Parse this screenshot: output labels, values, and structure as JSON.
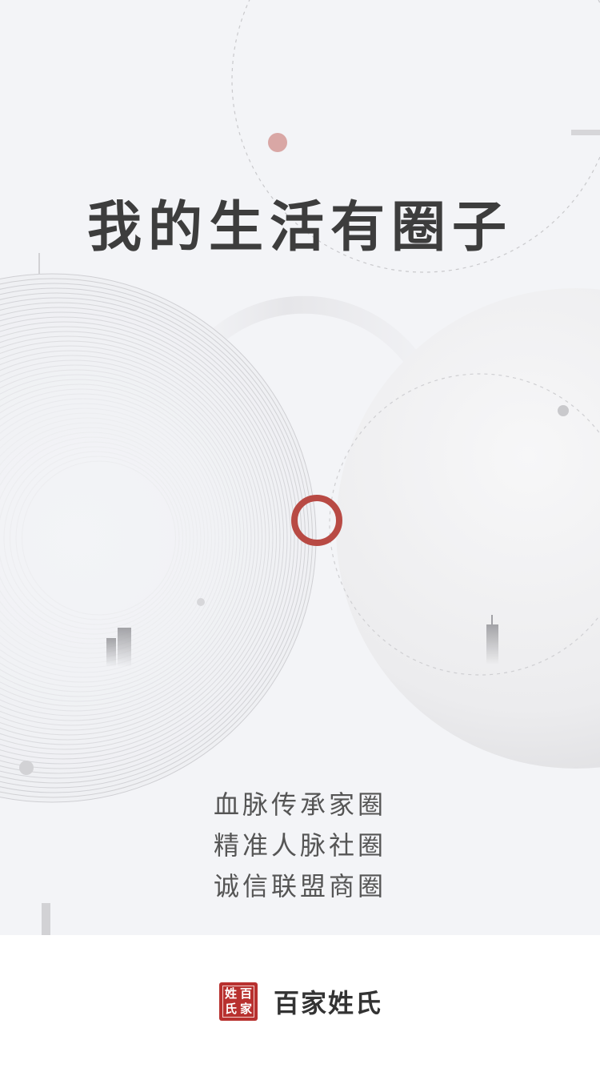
{
  "headline": "我的生活有圈子",
  "slogans": [
    "血脉传承家圈",
    "精准人脉社圈",
    "诚信联盟商圈"
  ],
  "brand": {
    "name": "百家姓氏",
    "seal_chars": [
      "姓",
      "百",
      "氏",
      "家"
    ],
    "seal_color": "#b8312f"
  },
  "colors": {
    "accent_ring": "#b84a44",
    "accent_dot": "#d9a7a5",
    "background": "#f3f4f7"
  }
}
